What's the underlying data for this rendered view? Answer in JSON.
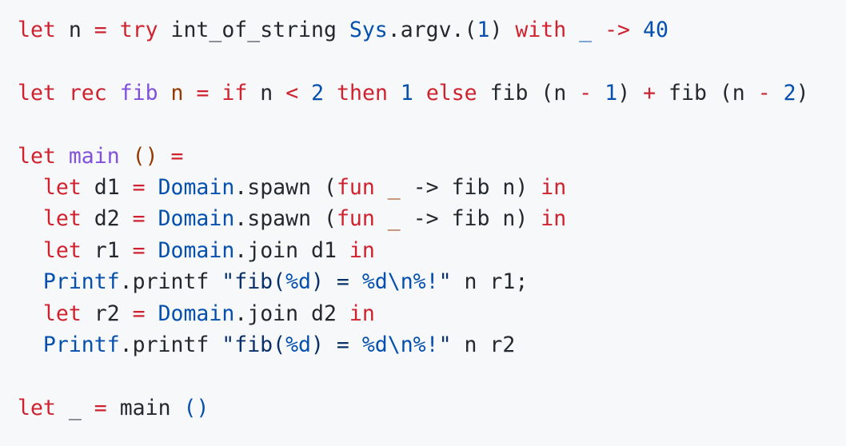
{
  "lines": [
    [
      {
        "t": "let",
        "k": "kw"
      },
      {
        "t": " n ",
        "k": "plain"
      },
      {
        "t": "=",
        "k": "kw"
      },
      {
        "t": " ",
        "k": "plain"
      },
      {
        "t": "try",
        "k": "kw"
      },
      {
        "t": " int_of_string ",
        "k": "plain"
      },
      {
        "t": "Sys",
        "k": "mod"
      },
      {
        "t": ".argv.",
        "k": "plain"
      },
      {
        "t": "(",
        "k": "plain"
      },
      {
        "t": "1",
        "k": "num"
      },
      {
        "t": ") ",
        "k": "plain"
      },
      {
        "t": "with",
        "k": "kw"
      },
      {
        "t": " ",
        "k": "plain"
      },
      {
        "t": "_",
        "k": "mod"
      },
      {
        "t": " ",
        "k": "plain"
      },
      {
        "t": "->",
        "k": "kw"
      },
      {
        "t": " ",
        "k": "plain"
      },
      {
        "t": "40",
        "k": "num"
      }
    ],
    [],
    [
      {
        "t": "let",
        "k": "kw"
      },
      {
        "t": " ",
        "k": "plain"
      },
      {
        "t": "rec",
        "k": "kw"
      },
      {
        "t": " ",
        "k": "plain"
      },
      {
        "t": "fib",
        "k": "fn"
      },
      {
        "t": " ",
        "k": "plain"
      },
      {
        "t": "n",
        "k": "var"
      },
      {
        "t": " ",
        "k": "plain"
      },
      {
        "t": "=",
        "k": "kw"
      },
      {
        "t": " ",
        "k": "plain"
      },
      {
        "t": "if",
        "k": "kw"
      },
      {
        "t": " n ",
        "k": "plain"
      },
      {
        "t": "<",
        "k": "kw"
      },
      {
        "t": " ",
        "k": "plain"
      },
      {
        "t": "2",
        "k": "num"
      },
      {
        "t": " ",
        "k": "plain"
      },
      {
        "t": "then",
        "k": "kw"
      },
      {
        "t": " ",
        "k": "plain"
      },
      {
        "t": "1",
        "k": "num"
      },
      {
        "t": " ",
        "k": "plain"
      },
      {
        "t": "else",
        "k": "kw"
      },
      {
        "t": " fib (n ",
        "k": "plain"
      },
      {
        "t": "-",
        "k": "kw"
      },
      {
        "t": " ",
        "k": "plain"
      },
      {
        "t": "1",
        "k": "num"
      },
      {
        "t": ") ",
        "k": "plain"
      },
      {
        "t": "+",
        "k": "kw"
      },
      {
        "t": " fib (n ",
        "k": "plain"
      },
      {
        "t": "-",
        "k": "kw"
      },
      {
        "t": " ",
        "k": "plain"
      },
      {
        "t": "2",
        "k": "num"
      },
      {
        "t": ")",
        "k": "plain"
      }
    ],
    [],
    [
      {
        "t": "let",
        "k": "kw"
      },
      {
        "t": " ",
        "k": "plain"
      },
      {
        "t": "main",
        "k": "fn"
      },
      {
        "t": " ",
        "k": "plain"
      },
      {
        "t": "()",
        "k": "var"
      },
      {
        "t": " ",
        "k": "plain"
      },
      {
        "t": "=",
        "k": "kw"
      }
    ],
    [
      {
        "t": "  ",
        "k": "plain"
      },
      {
        "t": "let",
        "k": "kw"
      },
      {
        "t": " d1 ",
        "k": "plain"
      },
      {
        "t": "=",
        "k": "kw"
      },
      {
        "t": " ",
        "k": "plain"
      },
      {
        "t": "Domain",
        "k": "mod"
      },
      {
        "t": ".spawn (",
        "k": "plain"
      },
      {
        "t": "fun",
        "k": "kw"
      },
      {
        "t": " ",
        "k": "plain"
      },
      {
        "t": "_",
        "k": "var"
      },
      {
        "t": " ",
        "k": "plain"
      },
      {
        "t": "->",
        "k": "plain"
      },
      {
        "t": " fib n) ",
        "k": "plain"
      },
      {
        "t": "in",
        "k": "kw"
      }
    ],
    [
      {
        "t": "  ",
        "k": "plain"
      },
      {
        "t": "let",
        "k": "kw"
      },
      {
        "t": " d2 ",
        "k": "plain"
      },
      {
        "t": "=",
        "k": "kw"
      },
      {
        "t": " ",
        "k": "plain"
      },
      {
        "t": "Domain",
        "k": "mod"
      },
      {
        "t": ".spawn (",
        "k": "plain"
      },
      {
        "t": "fun",
        "k": "kw"
      },
      {
        "t": " ",
        "k": "plain"
      },
      {
        "t": "_",
        "k": "var"
      },
      {
        "t": " ",
        "k": "plain"
      },
      {
        "t": "->",
        "k": "plain"
      },
      {
        "t": " fib n) ",
        "k": "plain"
      },
      {
        "t": "in",
        "k": "kw"
      }
    ],
    [
      {
        "t": "  ",
        "k": "plain"
      },
      {
        "t": "let",
        "k": "kw"
      },
      {
        "t": " r1 ",
        "k": "plain"
      },
      {
        "t": "=",
        "k": "kw"
      },
      {
        "t": " ",
        "k": "plain"
      },
      {
        "t": "Domain",
        "k": "mod"
      },
      {
        "t": ".join d1 ",
        "k": "plain"
      },
      {
        "t": "in",
        "k": "kw"
      }
    ],
    [
      {
        "t": "  ",
        "k": "plain"
      },
      {
        "t": "Printf",
        "k": "mod"
      },
      {
        "t": ".printf ",
        "k": "plain"
      },
      {
        "t": "\"fib(",
        "k": "str"
      },
      {
        "t": "%d",
        "k": "mod"
      },
      {
        "t": ") = ",
        "k": "str"
      },
      {
        "t": "%d",
        "k": "mod"
      },
      {
        "t": "\\n",
        "k": "mod"
      },
      {
        "t": "%!",
        "k": "mod"
      },
      {
        "t": "\"",
        "k": "str"
      },
      {
        "t": " n r1;",
        "k": "plain"
      }
    ],
    [
      {
        "t": "  ",
        "k": "plain"
      },
      {
        "t": "let",
        "k": "kw"
      },
      {
        "t": " r2 ",
        "k": "plain"
      },
      {
        "t": "=",
        "k": "kw"
      },
      {
        "t": " ",
        "k": "plain"
      },
      {
        "t": "Domain",
        "k": "mod"
      },
      {
        "t": ".join d2 ",
        "k": "plain"
      },
      {
        "t": "in",
        "k": "kw"
      }
    ],
    [
      {
        "t": "  ",
        "k": "plain"
      },
      {
        "t": "Printf",
        "k": "mod"
      },
      {
        "t": ".printf ",
        "k": "plain"
      },
      {
        "t": "\"fib(",
        "k": "str"
      },
      {
        "t": "%d",
        "k": "mod"
      },
      {
        "t": ") = ",
        "k": "str"
      },
      {
        "t": "%d",
        "k": "mod"
      },
      {
        "t": "\\n",
        "k": "mod"
      },
      {
        "t": "%!",
        "k": "mod"
      },
      {
        "t": "\"",
        "k": "str"
      },
      {
        "t": " n r2",
        "k": "plain"
      }
    ],
    [],
    [
      {
        "t": "let",
        "k": "kw"
      },
      {
        "t": " ",
        "k": "plain"
      },
      {
        "t": "_",
        "k": "plain"
      },
      {
        "t": " ",
        "k": "plain"
      },
      {
        "t": "=",
        "k": "kw"
      },
      {
        "t": " main ",
        "k": "plain"
      },
      {
        "t": "()",
        "k": "mod"
      }
    ]
  ],
  "colors": {
    "background": "#f6f8fa",
    "keyword": "#cf222e",
    "number": "#0550ae",
    "module": "#0550ae",
    "function": "#8250df",
    "parameter": "#953800",
    "string": "#0a3069",
    "text": "#24292f"
  }
}
